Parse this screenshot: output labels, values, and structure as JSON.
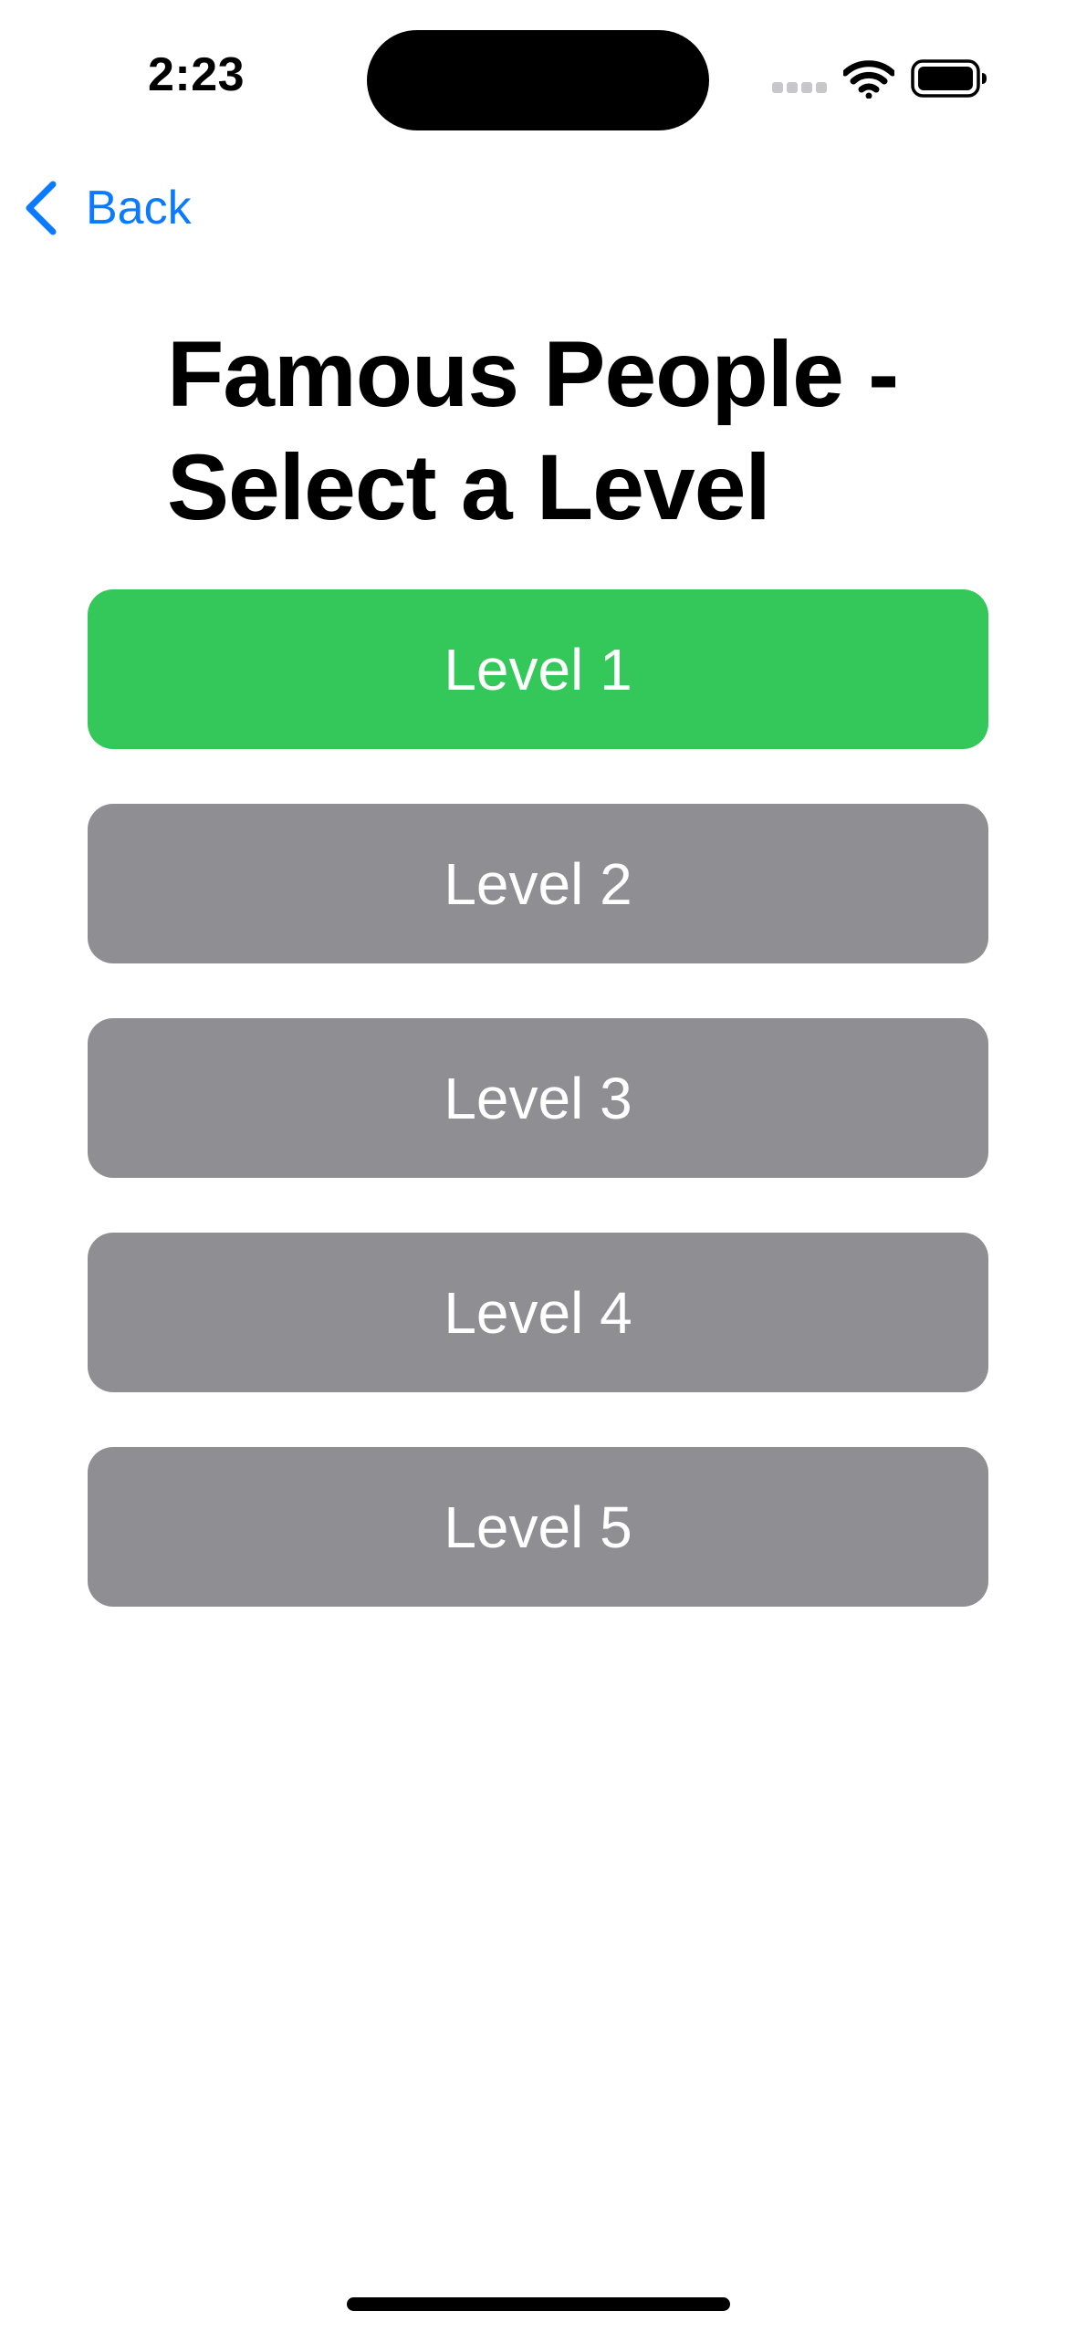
{
  "status_bar": {
    "time": "2:23"
  },
  "navigation": {
    "back_label": "Back",
    "back_icon": "chevron-left-icon",
    "accent_color": "#0a7aff"
  },
  "title": "Famous People - Select a Level",
  "levels": [
    {
      "label": "Level 1",
      "state": "selected",
      "color": "#34c759"
    },
    {
      "label": "Level 2",
      "state": "default",
      "color": "#8e8e93"
    },
    {
      "label": "Level 3",
      "state": "default",
      "color": "#8e8e93"
    },
    {
      "label": "Level 4",
      "state": "default",
      "color": "#8e8e93"
    },
    {
      "label": "Level 5",
      "state": "default",
      "color": "#8e8e93"
    }
  ]
}
